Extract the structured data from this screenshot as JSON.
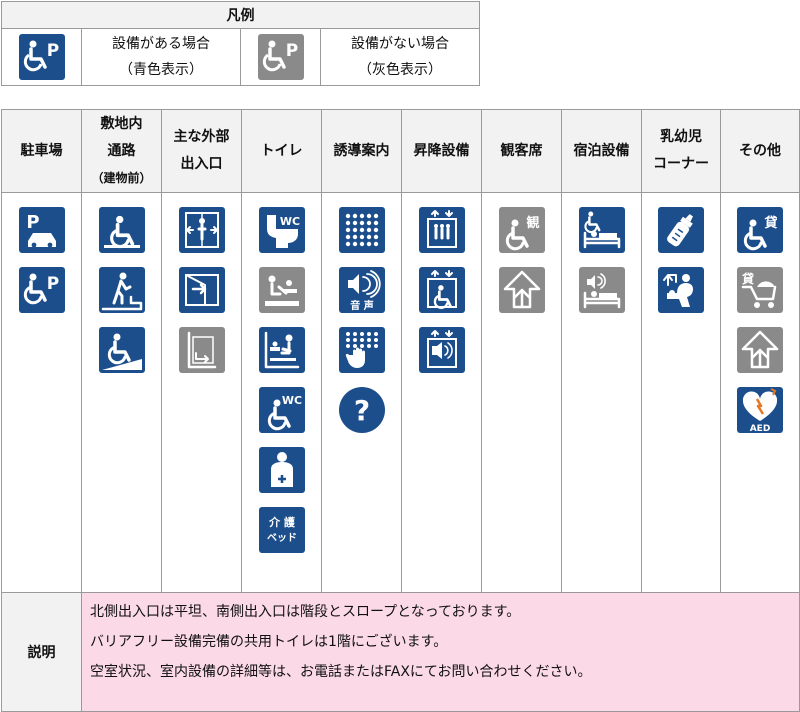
{
  "legend": {
    "title": "凡例",
    "available_label": "設備がある場合",
    "available_note": "（青色表示）",
    "unavailable_label": "設備がない場合",
    "unavailable_note": "（灰色表示）"
  },
  "colors": {
    "available": "#1c4e8c",
    "unavailable": "#8a8a8a",
    "header_bg": "#f2f2f2",
    "description_bg": "#fbd9e7"
  },
  "columns": [
    {
      "line1": "駐車場",
      "line2": "",
      "line3": "",
      "icons": [
        {
          "name": "parking-car-icon",
          "status": "available"
        },
        {
          "name": "accessible-parking-icon",
          "status": "available"
        }
      ]
    },
    {
      "line1": "敷地内",
      "line2": "通路",
      "line3": "（建物前）",
      "icons": [
        {
          "name": "wheelchair-icon",
          "status": "available"
        },
        {
          "name": "step-icon",
          "status": "available"
        },
        {
          "name": "wheelchair-slope-icon",
          "status": "available"
        }
      ]
    },
    {
      "line1": "主な外部",
      "line2": "出入口",
      "line3": "",
      "icons": [
        {
          "name": "automatic-door-icon",
          "status": "available"
        },
        {
          "name": "push-door-icon",
          "status": "available"
        },
        {
          "name": "sliding-door-icon",
          "status": "unavailable"
        }
      ]
    },
    {
      "line1": "トイレ",
      "line2": "",
      "line3": "",
      "icons": [
        {
          "name": "western-toilet-icon",
          "status": "available",
          "text": "WC"
        },
        {
          "name": "baby-changing-icon",
          "status": "unavailable"
        },
        {
          "name": "baby-chair-icon",
          "status": "available"
        },
        {
          "name": "accessible-toilet-icon",
          "status": "available",
          "text": "WC"
        },
        {
          "name": "ostomate-icon",
          "status": "available"
        },
        {
          "name": "care-bed-icon",
          "status": "available",
          "text": "介 護\nベッド"
        }
      ]
    },
    {
      "line1": "誘導案内",
      "line2": "",
      "line3": "",
      "icons": [
        {
          "name": "braille-icon",
          "status": "available"
        },
        {
          "name": "audio-guide-icon",
          "status": "available",
          "text": "音 声"
        },
        {
          "name": "tactile-map-icon",
          "status": "available"
        },
        {
          "name": "information-icon",
          "status": "available",
          "text": "?"
        }
      ]
    },
    {
      "line1": "昇降設備",
      "line2": "",
      "line3": "",
      "icons": [
        {
          "name": "elevator-icon",
          "status": "available"
        },
        {
          "name": "accessible-elevator-icon",
          "status": "available"
        },
        {
          "name": "elevator-audio-icon",
          "status": "available"
        }
      ]
    },
    {
      "line1": "観客席",
      "line2": "",
      "line3": "",
      "icons": [
        {
          "name": "wheelchair-seating-icon",
          "status": "unavailable",
          "text": "観"
        },
        {
          "name": "assistive-listening-icon",
          "status": "unavailable"
        }
      ]
    },
    {
      "line1": "宿泊設備",
      "line2": "",
      "line3": "",
      "icons": [
        {
          "name": "accessible-room-icon",
          "status": "available"
        },
        {
          "name": "hearing-room-icon",
          "status": "unavailable"
        }
      ]
    },
    {
      "line1": "乳幼児",
      "line2": "コーナー",
      "line3": "",
      "icons": [
        {
          "name": "baby-bottle-icon",
          "status": "available"
        },
        {
          "name": "nursing-room-icon",
          "status": "available"
        }
      ]
    },
    {
      "line1": "その他",
      "line2": "",
      "line3": "",
      "icons": [
        {
          "name": "wheelchair-rental-icon",
          "status": "available",
          "text": "貸"
        },
        {
          "name": "stroller-rental-icon",
          "status": "unavailable",
          "text": "貸"
        },
        {
          "name": "hearing-loop-icon",
          "status": "unavailable"
        },
        {
          "name": "aed-icon",
          "status": "available",
          "text": "AED"
        }
      ]
    }
  ],
  "description": {
    "label": "説明",
    "lines": [
      "北側出入口は平坦、南側出入口は階段とスロープとなっております。",
      "バリアフリー設備完備の共用トイレは1階にございます。",
      "空室状況、室内設備の詳細等は、お電話またはFAXにてお問い合わせください。"
    ]
  }
}
